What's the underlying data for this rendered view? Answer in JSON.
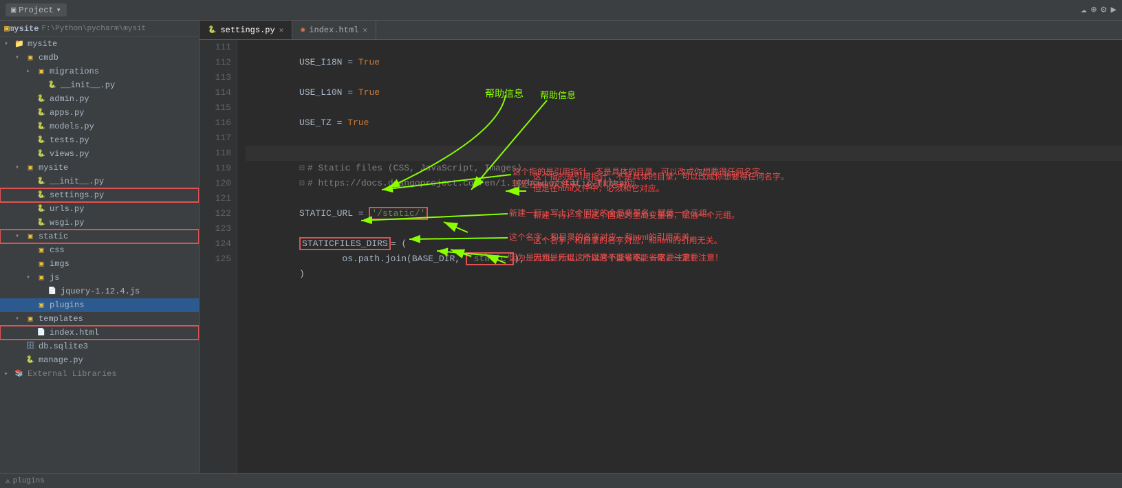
{
  "topbar": {
    "project_label": "Project",
    "project_dropdown": "▼",
    "icons": [
      "☁",
      "⚙",
      "🔧",
      "📋"
    ]
  },
  "tabs": [
    {
      "label": "settings.py",
      "active": true,
      "icon": "🐍",
      "closeable": true
    },
    {
      "label": "index.html",
      "active": false,
      "icon": "◉",
      "closeable": true
    }
  ],
  "sidebar": {
    "root_name": "mysite",
    "root_path": "F:\\Python\\pycharm\\mysit",
    "items": [
      {
        "label": "mysite",
        "type": "project",
        "indent": 0,
        "expanded": true
      },
      {
        "label": "cmdb",
        "type": "folder",
        "indent": 1,
        "expanded": true
      },
      {
        "label": "migrations",
        "type": "folder",
        "indent": 2,
        "expanded": false
      },
      {
        "label": "__init__.py",
        "type": "py",
        "indent": 3
      },
      {
        "label": "admin.py",
        "type": "py",
        "indent": 2
      },
      {
        "label": "apps.py",
        "type": "py",
        "indent": 2
      },
      {
        "label": "models.py",
        "type": "py",
        "indent": 2
      },
      {
        "label": "tests.py",
        "type": "py",
        "indent": 2
      },
      {
        "label": "views.py",
        "type": "py",
        "indent": 2
      },
      {
        "label": "mysite",
        "type": "folder",
        "indent": 1,
        "expanded": true
      },
      {
        "label": "__init__.py",
        "type": "py",
        "indent": 2
      },
      {
        "label": "settings.py",
        "type": "py",
        "indent": 2,
        "highlighted": true
      },
      {
        "label": "urls.py",
        "type": "py",
        "indent": 2
      },
      {
        "label": "wsgi.py",
        "type": "py",
        "indent": 2
      },
      {
        "label": "static",
        "type": "folder",
        "indent": 1,
        "expanded": true
      },
      {
        "label": "css",
        "type": "folder",
        "indent": 2
      },
      {
        "label": "imgs",
        "type": "folder",
        "indent": 2
      },
      {
        "label": "js",
        "type": "folder",
        "indent": 2,
        "expanded": true
      },
      {
        "label": "jquery-1.12.4.js",
        "type": "js",
        "indent": 3
      },
      {
        "label": "plugins",
        "type": "folder",
        "indent": 2,
        "selected": true
      },
      {
        "label": "templates",
        "type": "folder",
        "indent": 1,
        "expanded": true
      },
      {
        "label": "index.html",
        "type": "html",
        "indent": 2,
        "highlighted": true
      },
      {
        "label": "db.sqlite3",
        "type": "db",
        "indent": 1
      },
      {
        "label": "manage.py",
        "type": "py",
        "indent": 1
      },
      {
        "label": "External Libraries",
        "type": "extlib",
        "indent": 0
      }
    ]
  },
  "code": {
    "lines": [
      {
        "num": "111",
        "content": "USE_I18N = True",
        "tokens": [
          {
            "text": "USE_I18N",
            "cls": "kw-plain"
          },
          {
            "text": " = ",
            "cls": "kw-plain"
          },
          {
            "text": "True",
            "cls": "kw-var"
          }
        ]
      },
      {
        "num": "112",
        "content": "",
        "tokens": []
      },
      {
        "num": "113",
        "content": "USE_L10N = True",
        "tokens": [
          {
            "text": "USE_L10N",
            "cls": "kw-plain"
          },
          {
            "text": " = ",
            "cls": "kw-plain"
          },
          {
            "text": "True",
            "cls": "kw-var"
          }
        ]
      },
      {
        "num": "114",
        "content": "",
        "tokens": []
      },
      {
        "num": "115",
        "content": "USE_TZ = True",
        "tokens": [
          {
            "text": "USE_TZ",
            "cls": "kw-plain"
          },
          {
            "text": " = ",
            "cls": "kw-plain"
          },
          {
            "text": "True",
            "cls": "kw-var"
          }
        ]
      },
      {
        "num": "116",
        "content": "",
        "tokens": []
      },
      {
        "num": "117",
        "content": "",
        "tokens": []
      },
      {
        "num": "118",
        "content": "# Static files (CSS, JavaScript, Images)",
        "tokens": [
          {
            "text": "# Static files (CSS, JavaScript, Images)",
            "cls": "kw-comment"
          }
        ]
      },
      {
        "num": "119",
        "content": "# https://docs.djangoproject.com/en/1.10/howto/static-files/",
        "tokens": [
          {
            "text": "# https://docs.djangoproject.com/en/1.10/howto/static-files/",
            "cls": "kw-comment"
          }
        ]
      },
      {
        "num": "120",
        "content": "",
        "tokens": []
      },
      {
        "num": "121",
        "content": "STATIC_URL = '/static/'",
        "tokens": [
          {
            "text": "STATIC_URL",
            "cls": "kw-plain"
          },
          {
            "text": " = ",
            "cls": "kw-plain"
          },
          {
            "text": "'/static/'",
            "cls": "kw-string-red",
            "box": true
          }
        ]
      },
      {
        "num": "122",
        "content": "",
        "tokens": []
      },
      {
        "num": "123",
        "content": "STATICFILES_DIRS= (",
        "tokens": [
          {
            "text": "STATICFILES_DIRS",
            "cls": "kw-plain"
          },
          {
            "text": "= (",
            "cls": "kw-plain"
          }
        ]
      },
      {
        "num": "124",
        "content": "        os.path.join(BASE_DIR, 'static'),",
        "tokens": [
          {
            "text": "        os.path.join(BASE_DIR, ",
            "cls": "kw-plain"
          },
          {
            "text": "'static'",
            "cls": "kw-string-red",
            "box": true
          },
          {
            "text": ",",
            "cls": "kw-plain"
          }
        ]
      },
      {
        "num": "125",
        "content": ")",
        "tokens": [
          {
            "text": ")",
            "cls": "kw-plain"
          }
        ]
      }
    ]
  },
  "annotations": {
    "helptext_label": "帮助信息",
    "annotation1": "这个指的是引用指针，不是具体的目录，可以改成你想要得任何名字。",
    "annotation1b": "但是在html文件中，必须和它对应。",
    "annotation2": "新建一行，写上这个固定的全局变量名，赋值一个元组。",
    "annotation3": "这个名字，和目录的名字对应，和html的引用无关。",
    "annotation4": "因为是元组，所以这个逗号不能省略，一定要注意！"
  },
  "statusbar": {
    "text": "plugins"
  }
}
